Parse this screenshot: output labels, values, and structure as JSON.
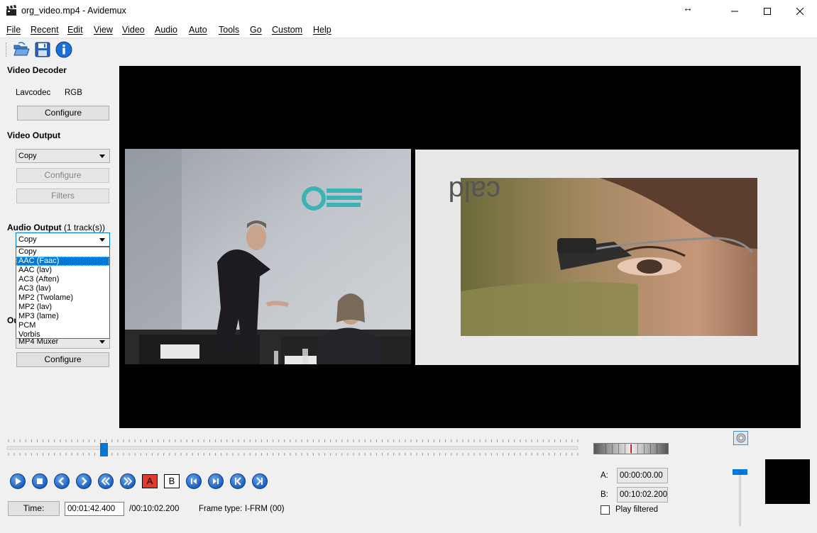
{
  "window": {
    "title": "org_video.mp4 - Avidemux"
  },
  "menu": [
    "File",
    "Recent",
    "Edit",
    "View",
    "Video",
    "Audio",
    "Auto",
    "Tools",
    "Go",
    "Custom",
    "Help"
  ],
  "toolbar": {
    "icons": [
      "open-folder-icon",
      "save-icon",
      "info-icon"
    ]
  },
  "video_decoder": {
    "heading": "Video Decoder",
    "codec": "Lavcodec",
    "format": "RGB",
    "configure_label": "Configure"
  },
  "video_output": {
    "heading": "Video Output",
    "selected": "Copy",
    "configure_label": "Configure",
    "filters_label": "Filters"
  },
  "audio_output": {
    "heading": "Audio Output",
    "tracks": "(1 track(s))",
    "selected": "Copy",
    "options": [
      "Copy",
      "AAC (Faac)",
      "AAC (lav)",
      "AC3 (Aften)",
      "AC3 (lav)",
      "MP2 (Twolame)",
      "MP2 (lav)",
      "MP3 (lame)",
      "PCM",
      "Vorbis"
    ],
    "highlighted_index": 1
  },
  "output_format": {
    "heading_fragment": "Ou",
    "selected": "MP4 Muxer",
    "configure_label": "Configure"
  },
  "timeline": {
    "position_fraction": 0.17
  },
  "playback": {
    "buttons": [
      "play-icon",
      "stop-icon",
      "previous-frame-icon",
      "next-frame-icon",
      "rewind-icon",
      "fast-forward-icon",
      "marker-a-icon",
      "marker-b-icon",
      "previous-keyframe-icon",
      "next-keyframe-icon",
      "go-start-icon",
      "go-end-icon"
    ],
    "marker_a_label": "A",
    "marker_b_label": "B"
  },
  "status": {
    "time_button": "Time:",
    "current_time": "00:01:42.400",
    "total_time": "/00:10:02.200",
    "frame_type_label": "Frame type:",
    "frame_type_value": "I-FRM (00)"
  },
  "selection": {
    "a_label": "A:",
    "a_value": "00:00:00.00",
    "b_label": "B:",
    "b_value": "00:10:02.200",
    "play_filtered_label": "Play filtered",
    "play_filtered_checked": false
  },
  "volume": {
    "level_fraction": 0.95
  },
  "colors": {
    "accent": "#0078d7",
    "video_bg": "#000000",
    "marker_red": "#e23a2e"
  }
}
